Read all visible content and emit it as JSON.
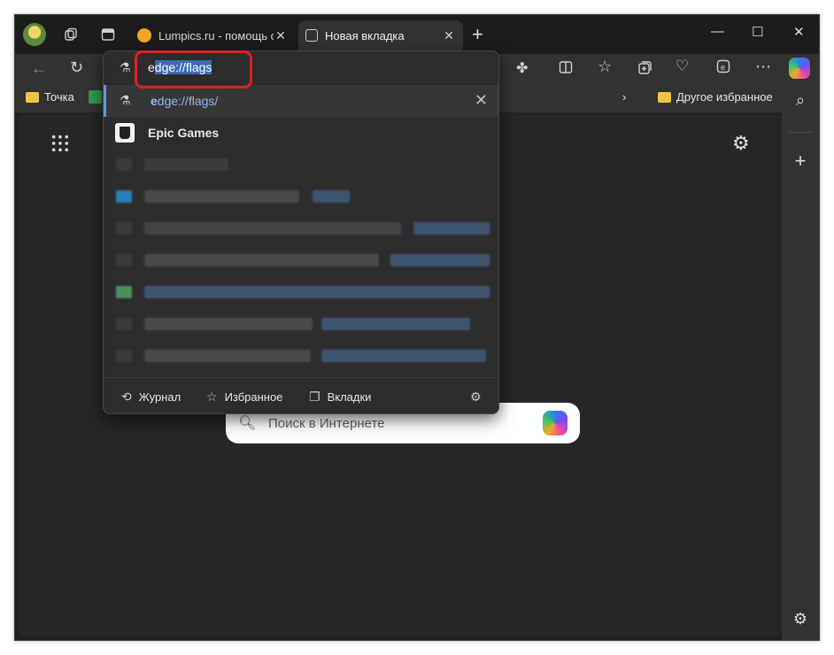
{
  "tabs": [
    {
      "title": "Lumpics.ru - помощь с",
      "close": "✕"
    },
    {
      "title": "Новая вкладка",
      "close": "✕"
    }
  ],
  "window_controls": {
    "minimize": "—",
    "maximize": "☐",
    "close": "✕"
  },
  "address": {
    "typed_prefix": "e",
    "selected_suffix": "dge://flags"
  },
  "suggestions": {
    "first": {
      "bold": "e",
      "rest": "dge://flags/"
    },
    "second": {
      "label": "Epic Games"
    }
  },
  "footer": {
    "history": "Журнал",
    "favorites": "Избранное",
    "tabs": "Вкладки"
  },
  "bookmarks": {
    "item1": "Точка",
    "other": "Другое избранное"
  },
  "search": {
    "placeholder": "Поиск в Интернете"
  },
  "colors": {
    "highlight": "#e0201e",
    "selection": "#3d6bb3"
  }
}
